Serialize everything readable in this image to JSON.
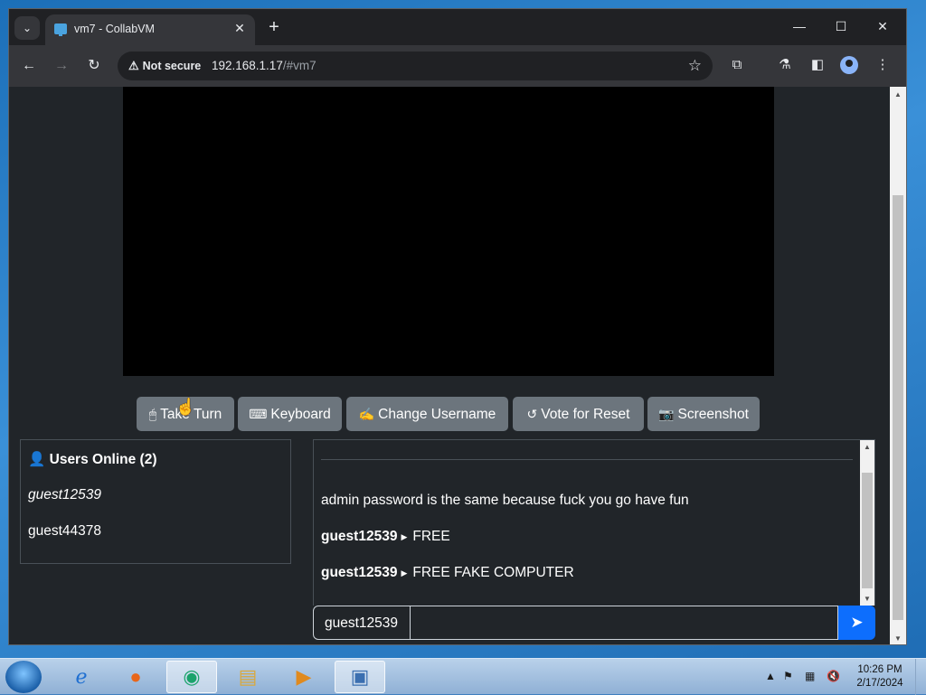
{
  "tab": {
    "title": "vm7 - CollabVM",
    "close": "✕"
  },
  "new_tab": "+",
  "window_controls": {
    "minimize": "—",
    "maximize": "☐",
    "close": "✕"
  },
  "omnibox": {
    "security": "Not secure",
    "host": "192.168.1.17",
    "path": "/#vm7"
  },
  "buttons": {
    "take_turn": "Take Turn",
    "keyboard": "Keyboard",
    "change_username": "Change Username",
    "vote_for_reset": "Vote for Reset",
    "screenshot": "Screenshot"
  },
  "users": {
    "header": "Users Online (2)",
    "list": [
      "guest12539",
      "guest44378"
    ]
  },
  "chat": {
    "messages": [
      {
        "user": "",
        "text": "admin password is the same because fuck you go have fun"
      },
      {
        "user": "guest12539",
        "text": "FREE"
      },
      {
        "user": "guest12539",
        "text": "FREE FAKE COMPUTER"
      }
    ],
    "username": "guest12539",
    "message_value": ""
  },
  "clock": {
    "time": "10:26 PM",
    "date": "2/17/2024"
  },
  "icons": {
    "tab_search": "chevron-down-icon",
    "back": "arrow-left-icon",
    "forward": "arrow-right-icon",
    "reload": "reload-icon",
    "warning": "warning-icon",
    "bookmark": "star-icon",
    "extensions": "puzzle-icon",
    "labs": "flask-icon",
    "sidepanel": "sidepanel-icon",
    "profile": "profile-icon",
    "menu": "kebab-menu-icon",
    "send": "paper-plane-icon"
  },
  "colors": {
    "accent": "#0d6efd",
    "button": "#6c757d",
    "page_bg": "#212529"
  }
}
